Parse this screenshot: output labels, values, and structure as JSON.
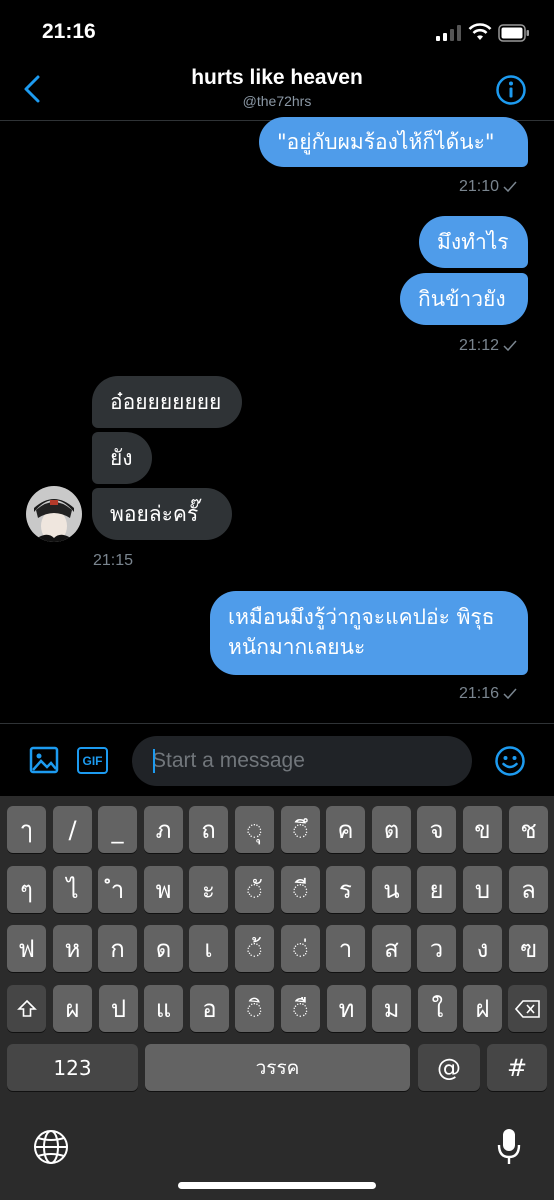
{
  "status_bar": {
    "time": "21:16"
  },
  "header": {
    "title": "hurts like heaven",
    "handle": "@the72hrs"
  },
  "messages": {
    "m1": "\"อยู่กับผมร้องไห้ก็ได้นะ\"",
    "t1": "21:10",
    "m2": "มึงทำไร",
    "m3": "กินข้าวยัง",
    "t2": "21:12",
    "r1": "อ๋อยยยยยยย",
    "r2": "ยัง",
    "r3": "พอยล่ะครั๊",
    "t3": "21:15",
    "m4_line1": "เหมือนมึงรู้ว่ากูจะแคปอ่ะ พิรุธ",
    "m4_line2": "หนักมากเลยนะ",
    "t4": "21:16"
  },
  "composer": {
    "placeholder": "Start a message",
    "gif_label": "GIF"
  },
  "keyboard": {
    "row1": [
      "ๅ",
      "/",
      "_",
      "ภ",
      "ถ",
      "ุ",
      "ึ",
      "ค",
      "ต",
      "จ",
      "ข",
      "ช"
    ],
    "row2": [
      "ๆ",
      "ไ",
      "ำ",
      "พ",
      "ะ",
      "ั",
      "ี",
      "ร",
      "น",
      "ย",
      "บ",
      "ล"
    ],
    "row3": [
      "ฟ",
      "ห",
      "ก",
      "ด",
      "เ",
      "้",
      "่",
      "า",
      "ส",
      "ว",
      "ง",
      "ฃ"
    ],
    "row4": [
      "ผ",
      "ป",
      "แ",
      "อ",
      "ิ",
      "ื",
      "ท",
      "ม",
      "ใ",
      "ฝ"
    ],
    "numbers_key": "123",
    "space_key": "วรรค",
    "at_key": "@",
    "hash_key": "#"
  },
  "colors": {
    "accent": "#1d9bf0",
    "outgoing_bubble": "#4f9cea",
    "incoming_bubble": "#2f3336",
    "background": "#000000"
  }
}
